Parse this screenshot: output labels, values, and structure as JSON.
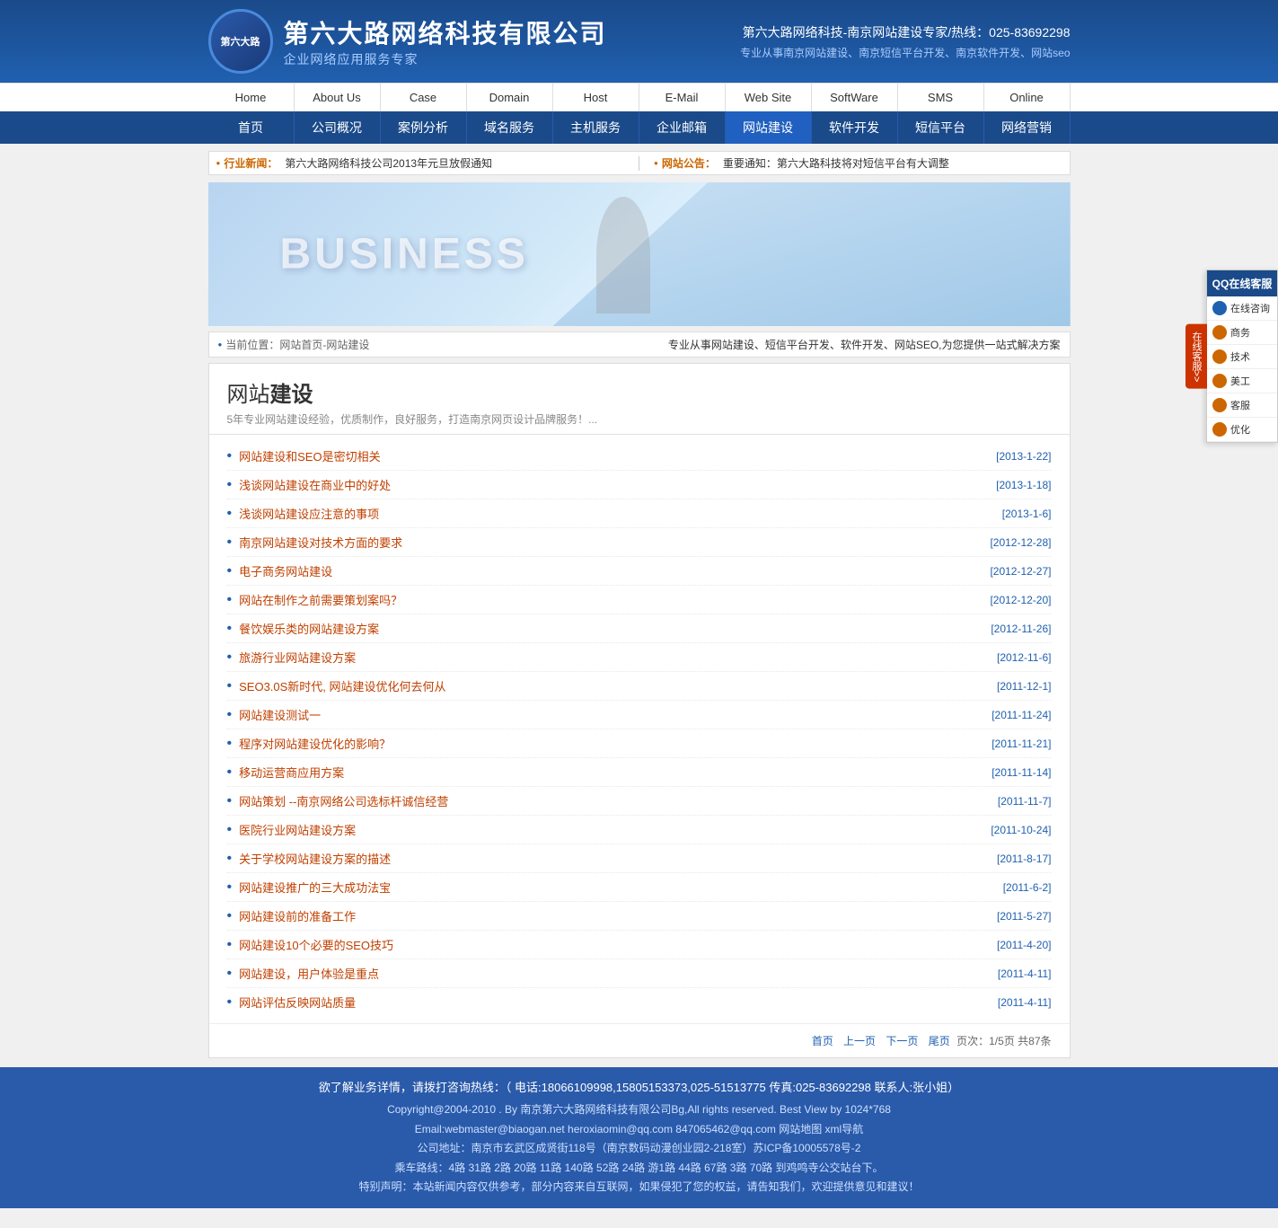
{
  "site": {
    "name": "第六大路网络科技有限公司",
    "slogan": "企业网络应用服务专家",
    "logo_text": "第六大路",
    "hotline_label": "第六大路网络科技-南京网站建设专家/热线：025-83692298",
    "services_text": "专业从事南京网站建设、南京短信平台开发、南京软件开发、网站seo"
  },
  "nav_top": {
    "items": [
      {
        "label": "Home",
        "id": "home"
      },
      {
        "label": "About Us",
        "id": "about"
      },
      {
        "label": "Case",
        "id": "case"
      },
      {
        "label": "Domain",
        "id": "domain"
      },
      {
        "label": "Host",
        "id": "host"
      },
      {
        "label": "E-Mail",
        "id": "email"
      },
      {
        "label": "Web Site",
        "id": "website"
      },
      {
        "label": "SoftWare",
        "id": "software"
      },
      {
        "label": "SMS",
        "id": "sms"
      },
      {
        "label": "Online",
        "id": "online"
      }
    ]
  },
  "nav_bottom": {
    "items": [
      {
        "label": "首页",
        "id": "index"
      },
      {
        "label": "公司概况",
        "id": "company"
      },
      {
        "label": "案例分析",
        "id": "cases"
      },
      {
        "label": "域名服务",
        "id": "domain"
      },
      {
        "label": "主机服务",
        "id": "host"
      },
      {
        "label": "企业邮箱",
        "id": "email"
      },
      {
        "label": "网站建设",
        "id": "website",
        "active": true
      },
      {
        "label": "软件开发",
        "id": "software"
      },
      {
        "label": "短信平台",
        "id": "sms"
      },
      {
        "label": "网络营销",
        "id": "marketing"
      }
    ]
  },
  "ticker": {
    "industry_label": "行业新闻：",
    "industry_text": "第六大路网络科技公司2013年元旦放假通知",
    "website_label": "网站公告：",
    "website_text": "重要通知：第六大路科技将对短信平台有大调整"
  },
  "breadcrumb": {
    "path": "当前位置：网站首页-网站建设",
    "description": "专业从事网站建设、短信平台开发、软件开发、网站SEO,为您提供一站式解决方案"
  },
  "content": {
    "title_prefix": "网站",
    "title_bold": "建设",
    "subtitle": "5年专业网站建设经验，优质制作，良好服务，打造南京网页设计品牌服务！...",
    "articles": [
      {
        "title": "网站建设和SEO是密切相关",
        "date": "[2013-1-22]"
      },
      {
        "title": "浅谈网站建设在商业中的好处",
        "date": "[2013-1-18]"
      },
      {
        "title": "浅谈网站建设应注意的事项",
        "date": "[2013-1-6]"
      },
      {
        "title": "南京网站建设对技术方面的要求",
        "date": "[2012-12-28]"
      },
      {
        "title": "电子商务网站建设",
        "date": "[2012-12-27]"
      },
      {
        "title": "网站在制作之前需要策划案吗？",
        "date": "[2012-12-20]"
      },
      {
        "title": "餐饮娱乐类的网站建设方案",
        "date": "[2012-11-26]"
      },
      {
        "title": "旅游行业网站建设方案",
        "date": "[2012-11-6]"
      },
      {
        "title": "SEO3.0S新时代, 网站建设优化何去何从",
        "date": "[2011-12-1]"
      },
      {
        "title": "网站建设测试一",
        "date": "[2011-11-24]"
      },
      {
        "title": "程序对网站建设优化的影响？",
        "date": "[2011-11-21]"
      },
      {
        "title": "移动运营商应用方案",
        "date": "[2011-11-14]"
      },
      {
        "title": "网站策划 --南京网络公司选标杆诚信经营",
        "date": "[2011-11-7]"
      },
      {
        "title": "医院行业网站建设方案",
        "date": "[2011-10-24]"
      },
      {
        "title": "关于学校网站建设方案的描述",
        "date": "[2011-8-17]"
      },
      {
        "title": "网站建设推广的三大成功法宝",
        "date": "[2011-6-2]"
      },
      {
        "title": "网站建设前的准备工作",
        "date": "[2011-5-27]"
      },
      {
        "title": "网站建设10个必要的SEO技巧",
        "date": "[2011-4-20]"
      },
      {
        "title": "网站建设，用户体验是重点",
        "date": "[2011-4-11]"
      },
      {
        "title": "网站评估反映网站质量",
        "date": "[2011-4-11]"
      }
    ],
    "pagination": {
      "first": "首页",
      "prev": "上一页",
      "next": "下一页",
      "last": "尾页",
      "info": "页次：1/5页  共87条"
    }
  },
  "sidebar_qq": {
    "title": "QQ在线客服",
    "items": [
      {
        "label": "在线咨询",
        "type": "blue"
      },
      {
        "label": "商务",
        "type": "orange"
      },
      {
        "label": "技术",
        "type": "orange"
      },
      {
        "label": "美工",
        "type": "orange"
      },
      {
        "label": "客服",
        "type": "orange"
      },
      {
        "label": "优化",
        "type": "orange"
      }
    ],
    "tab_label": "在线客服>>"
  },
  "footer": {
    "contact": "欲了解业务详情，请拨打咨询热线：（ 电话:18066109998,15805153373,025-51513775 传真:025-83692298 联系人:张小姐）",
    "copyright": "Copyright@2004-2010 . By 南京第六大路网络科技有限公司Bg,All rights reserved. Best View by 1024*768",
    "email_info": "Email:webmaster@biaogan.net  heroxiaomin@qq.com  847065462@qq.com  网站地图  xml导航",
    "address": "公司地址：南京市玄武区成贤街118号（南京数码动漫创业园2-218室）苏ICP备10005578号-2",
    "bus": "乘车路线：4路  31路  2路  20路  11路  140路  52路  24路  游1路  44路  67路  3路  70路  到鸡鸣寺公交站台下。",
    "disclaimer": "特别声明：本站新闻内容仅供参考，部分内容来自互联网，如果侵犯了您的权益，请告知我们，欢迎提供意见和建议！"
  }
}
